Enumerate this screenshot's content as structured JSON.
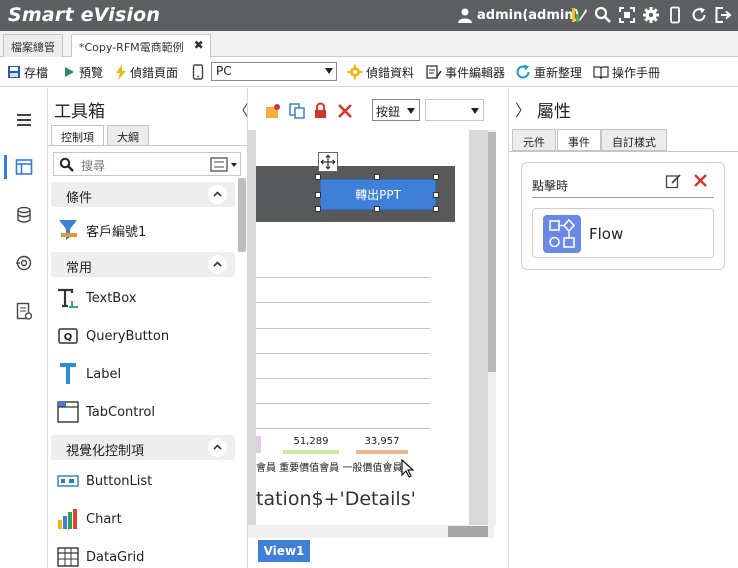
{
  "app": {
    "title": "Smart eVision",
    "user": "admin(admin)"
  },
  "doc_tabs": [
    {
      "label": "檔案總管"
    },
    {
      "label": "*Copy-RFM電商範例"
    }
  ],
  "toolbar": {
    "save": "存檔",
    "preview": "預覽",
    "debug_page": "偵錯頁面",
    "device": "PC",
    "debug_data": "偵錯資料",
    "event_editor": "事件編輯器",
    "refresh": "重新整理",
    "manual": "操作手冊"
  },
  "toolbox": {
    "title": "工具箱",
    "tabs": [
      "控制項",
      "大綱"
    ],
    "search_placeholder": "搜尋",
    "groups": [
      {
        "label": "條件",
        "items": [
          {
            "label": "客戶編號1",
            "icon": "filter-icon"
          }
        ]
      },
      {
        "label": "常用",
        "items": [
          {
            "label": "TextBox",
            "icon": "textbox-icon"
          },
          {
            "label": "QueryButton",
            "icon": "querybutton-icon"
          },
          {
            "label": "Label",
            "icon": "label-icon"
          },
          {
            "label": "TabControl",
            "icon": "tabcontrol-icon"
          }
        ]
      },
      {
        "label": "視覺化控制項",
        "items": [
          {
            "label": "ButtonList",
            "icon": "buttonlist-icon"
          },
          {
            "label": "Chart",
            "icon": "chart-icon"
          },
          {
            "label": "DataGrid",
            "icon": "datagrid-icon"
          }
        ]
      }
    ]
  },
  "canvas": {
    "button_select": "按鈕",
    "ppt_button": "轉出PPT",
    "bar_values": [
      "51,289",
      "33,957"
    ],
    "category_labels": "會員 重要價值會員 一般價值會員",
    "expression_text": "tation$+'Details'",
    "view_tab": "View1"
  },
  "props": {
    "title": "屬性",
    "tabs": [
      "元件",
      "事件",
      "自訂樣式"
    ],
    "event_name": "點擊時",
    "flow_label": "Flow"
  },
  "colors": {
    "accent": "#3f7fd8",
    "topbar": "#5d5f62",
    "delete": "#d9342b",
    "flow_icon": "#6a88e5"
  }
}
